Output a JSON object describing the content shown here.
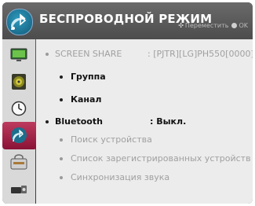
{
  "header": {
    "title": "БЕСПРОВОДНОЙ РЕЖИМ",
    "hint_move": "Переместить",
    "hint_ok": "OK",
    "icon": "bluetooth-wireless-icon"
  },
  "sidebar": {
    "items": [
      {
        "icon": "monitor-icon"
      },
      {
        "icon": "speaker-icon"
      },
      {
        "icon": "clock-icon"
      },
      {
        "icon": "wireless-bluetooth-icon",
        "active": true
      },
      {
        "icon": "lock-icon"
      },
      {
        "icon": "usb-devices-icon"
      }
    ],
    "accent_color": "#a52047"
  },
  "menu": {
    "screen_share_label": "SCREEN SHARE",
    "screen_share_value": ": [PJTR][LG]PH550[0000]",
    "group_label": "Группа",
    "channel_label": "Канал",
    "bluetooth_label": "Bluetooth",
    "bluetooth_value": ": Выкл.",
    "device_search_label": "Поиск устройства",
    "registered_devices_label": "Список зарегистрированных устройств",
    "sound_sync_label": "Синхронизация звука"
  }
}
